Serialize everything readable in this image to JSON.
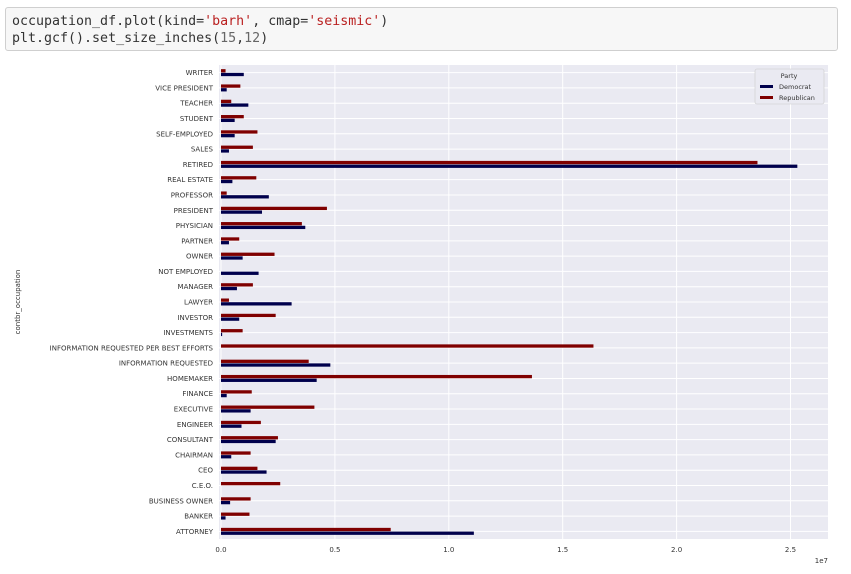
{
  "code": {
    "line1": {
      "prefix": "occupation_df.plot(kind=",
      "kind": "'barh'",
      "mid": ", cmap=",
      "cmap": "'seismic'",
      "suffix": ")"
    },
    "line2": {
      "prefix": "plt.gcf().set_size_inches(",
      "w": "15",
      "sep": ",",
      "h": "12",
      "suffix": ")"
    }
  },
  "colors": {
    "plot_bg": "#eaeaf2",
    "grid": "#ffffff",
    "democrat": "#00004c",
    "republican": "#7f0000"
  },
  "chart_data": {
    "type": "bar",
    "orientation": "horizontal",
    "ylabel": "contbr_occupation",
    "xlabel": "",
    "x_multiplier": "1e7",
    "xlim": [
      0,
      2.65
    ],
    "xticks": [
      0.0,
      0.5,
      1.0,
      1.5,
      2.0,
      2.5
    ],
    "xtick_labels": [
      "0.0",
      "0.5",
      "1.0",
      "1.5",
      "2.0",
      "2.5"
    ],
    "grid": true,
    "legend": {
      "title": "Party",
      "placement": "top-right"
    },
    "categories": [
      "ATTORNEY",
      "BANKER",
      "BUSINESS OWNER",
      "C.E.O.",
      "CEO",
      "CHAIRMAN",
      "CONSULTANT",
      "ENGINEER",
      "EXECUTIVE",
      "FINANCE",
      "HOMEMAKER",
      "INFORMATION REQUESTED",
      "INFORMATION REQUESTED PER BEST EFFORTS",
      "INVESTMENTS",
      "INVESTOR",
      "LAWYER",
      "MANAGER",
      "NOT EMPLOYED",
      "OWNER",
      "PARTNER",
      "PHYSICIAN",
      "PRESIDENT",
      "PROFESSOR",
      "REAL ESTATE",
      "RETIRED",
      "SALES",
      "SELF-EMPLOYED",
      "STUDENT",
      "TEACHER",
      "VICE PRESIDENT",
      "WRITER"
    ],
    "series": [
      {
        "name": "Democrat",
        "values": [
          1.11,
          0.02,
          0.04,
          0.0,
          0.2,
          0.045,
          0.24,
          0.09,
          0.13,
          0.025,
          0.42,
          0.48,
          0.0,
          0.005,
          0.08,
          0.31,
          0.07,
          0.165,
          0.095,
          0.035,
          0.37,
          0.18,
          0.21,
          0.05,
          2.53,
          0.035,
          0.06,
          0.06,
          0.12,
          0.025,
          0.1
        ]
      },
      {
        "name": "Republican",
        "values": [
          0.745,
          0.125,
          0.13,
          0.26,
          0.16,
          0.13,
          0.25,
          0.175,
          0.41,
          0.135,
          1.365,
          0.385,
          1.635,
          0.095,
          0.24,
          0.035,
          0.14,
          0.0,
          0.235,
          0.08,
          0.355,
          0.465,
          0.025,
          0.155,
          2.355,
          0.14,
          0.16,
          0.1,
          0.045,
          0.085,
          0.02
        ]
      }
    ]
  }
}
